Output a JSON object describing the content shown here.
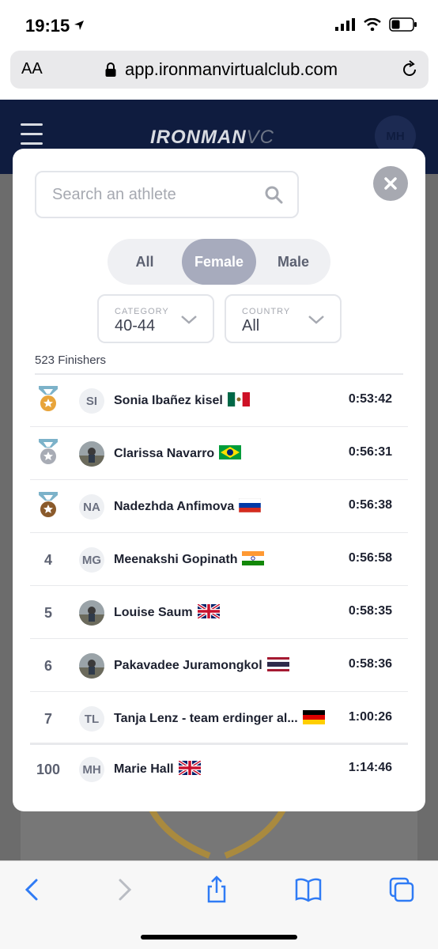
{
  "status": {
    "time": "19:15"
  },
  "browser": {
    "aa_label": "AA",
    "url": "app.ironmanvirtualclub.com"
  },
  "app": {
    "logo_main": "IRONMAN",
    "logo_suffix": "VC",
    "user_initials": "MH"
  },
  "modal": {
    "search_placeholder": "Search an athlete",
    "segments": [
      {
        "label": "All",
        "active": false
      },
      {
        "label": "Female",
        "active": true
      },
      {
        "label": "Male",
        "active": false
      }
    ],
    "category": {
      "label": "CATEGORY",
      "value": "40-44"
    },
    "country": {
      "label": "COUNTRY",
      "value": "All"
    },
    "finishers": "523 Finishers",
    "rows": [
      {
        "rank": "",
        "medal": "gold",
        "initials": "SI",
        "photo": false,
        "name": "Sonia Ibañez kisel",
        "flag": "mexico",
        "time": "0:53:42"
      },
      {
        "rank": "",
        "medal": "silver",
        "initials": "",
        "photo": true,
        "name": "Clarissa Navarro",
        "flag": "brazil",
        "time": "0:56:31"
      },
      {
        "rank": "",
        "medal": "bronze",
        "initials": "NA",
        "photo": false,
        "name": "Nadezhda Anfimova",
        "flag": "russia",
        "time": "0:56:38"
      },
      {
        "rank": "4",
        "medal": "",
        "initials": "MG",
        "photo": false,
        "name": "Meenakshi Gopinath",
        "flag": "india",
        "time": "0:56:58"
      },
      {
        "rank": "5",
        "medal": "",
        "initials": "",
        "photo": true,
        "name": "Louise Saum",
        "flag": "uk",
        "time": "0:58:35"
      },
      {
        "rank": "6",
        "medal": "",
        "initials": "",
        "photo": true,
        "name": "Pakavadee Juramongkol",
        "flag": "thailand",
        "time": "0:58:36"
      },
      {
        "rank": "7",
        "medal": "",
        "initials": "TL",
        "photo": false,
        "name": "Tanja Lenz - team erdinger al...",
        "flag": "germany",
        "time": "1:00:26"
      },
      {
        "rank": "100",
        "medal": "",
        "initials": "MH",
        "photo": false,
        "name": "Marie Hall",
        "flag": "uk",
        "time": "1:14:46"
      }
    ]
  },
  "colors": {
    "navy": "#0f1c3f",
    "gold": "#e8a43a",
    "silver": "#a8acb5",
    "bronze": "#8a5a2b",
    "medal_ribbon": "#7cb2c9"
  }
}
